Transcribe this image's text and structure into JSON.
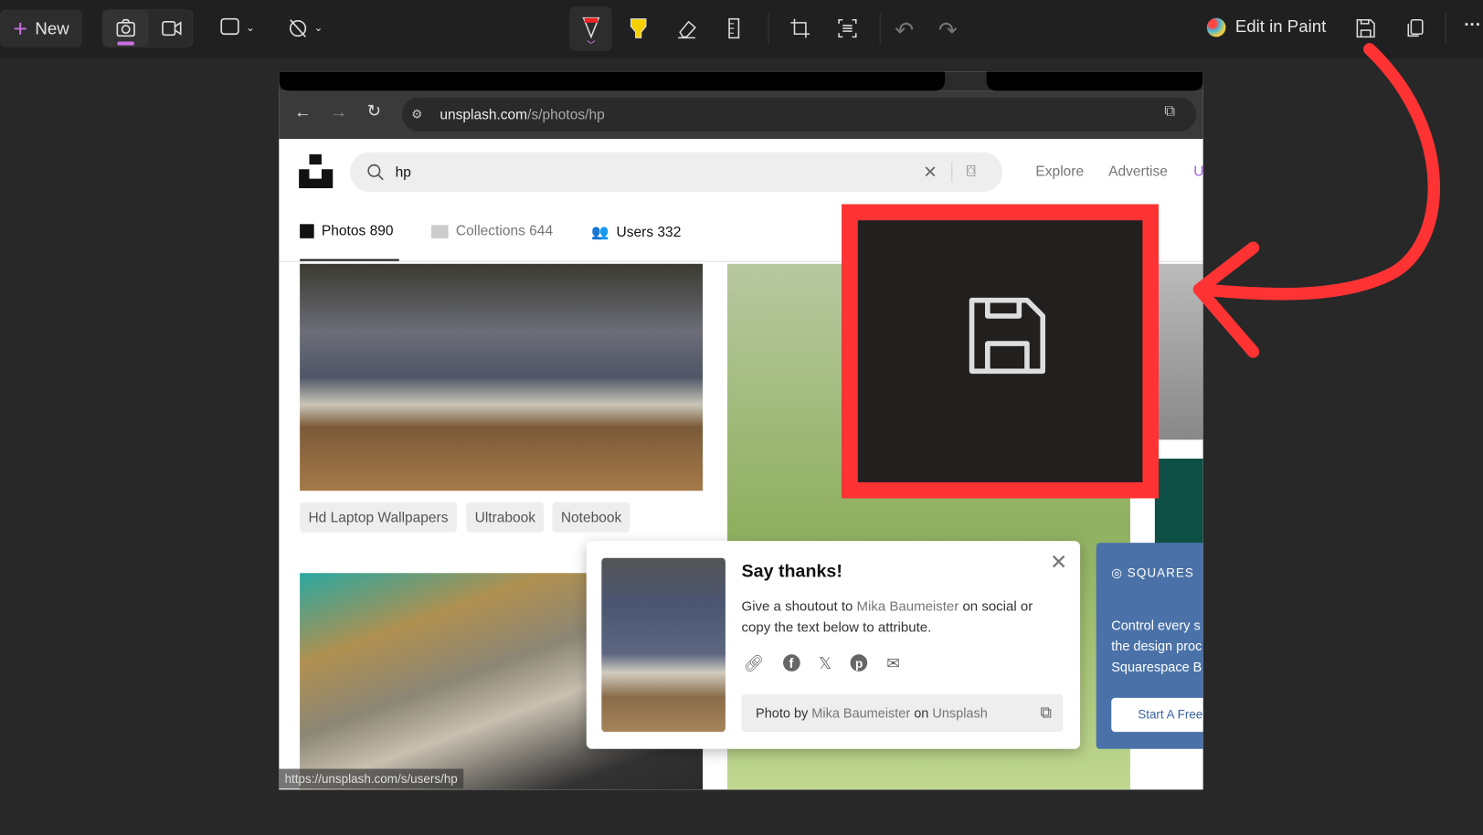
{
  "toolbar": {
    "new_label": "New",
    "edit_in_paint": "Edit in Paint",
    "more": "···"
  },
  "browser": {
    "url_host": "unsplash.com",
    "url_path": "/s/photos/hp",
    "status_url": "https://unsplash.com/s/users/hp"
  },
  "unsplash": {
    "search_value": "hp",
    "nav": [
      "Explore",
      "Advertise",
      "U"
    ],
    "tabs": [
      {
        "label": "Photos 890",
        "active": true
      },
      {
        "label": "Collections 644"
      },
      {
        "label": "Users 332"
      }
    ],
    "chips": [
      "Hd Laptop Wallpapers",
      "Ultrabook",
      "Notebook"
    ]
  },
  "popup": {
    "title": "Say thanks!",
    "text_before": "Give a shoutout to ",
    "author": "Mika Baumeister",
    "text_after": " on social or copy the text below to attribute.",
    "credit_prefix": "Photo by ",
    "credit_on": " on ",
    "credit_site": "Unsplash"
  },
  "ad": {
    "brand": "SQUARES",
    "body": "Control every s the design proc Squarespace B",
    "cta": "Start A Free"
  },
  "colors": {
    "annotation": "#ff3333",
    "accent": "#c86fe0"
  }
}
